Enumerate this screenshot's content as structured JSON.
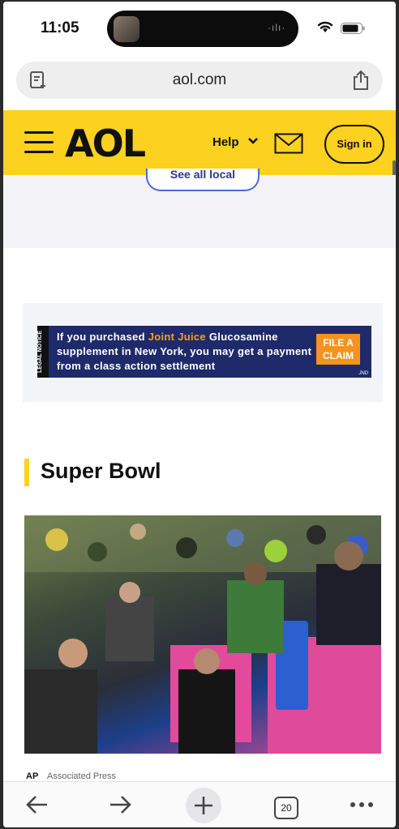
{
  "status_bar": {
    "time": "11:05"
  },
  "browser": {
    "url": "aol.com",
    "tab_count": "20"
  },
  "aol_header": {
    "logo": "AOL",
    "help_label": "Help",
    "sign_in_label": "Sign in"
  },
  "local": {
    "see_all_label": "See all local"
  },
  "ad": {
    "legal_notice": "LEGAL NOTICE",
    "text_before": "If you purchased ",
    "highlight": "Joint Juice",
    "text_after": " Glucosamine supplement in New York, you may get a payment from a class action settlement",
    "cta": "FILE A CLAIM",
    "brand": "JND"
  },
  "section": {
    "title": "Super Bowl",
    "source_logo": "AP",
    "source_name": "Associated Press"
  },
  "colors": {
    "brand_yellow": "#fcd11f",
    "ad_navy": "#1e2a6a",
    "ad_orange": "#f59320"
  }
}
